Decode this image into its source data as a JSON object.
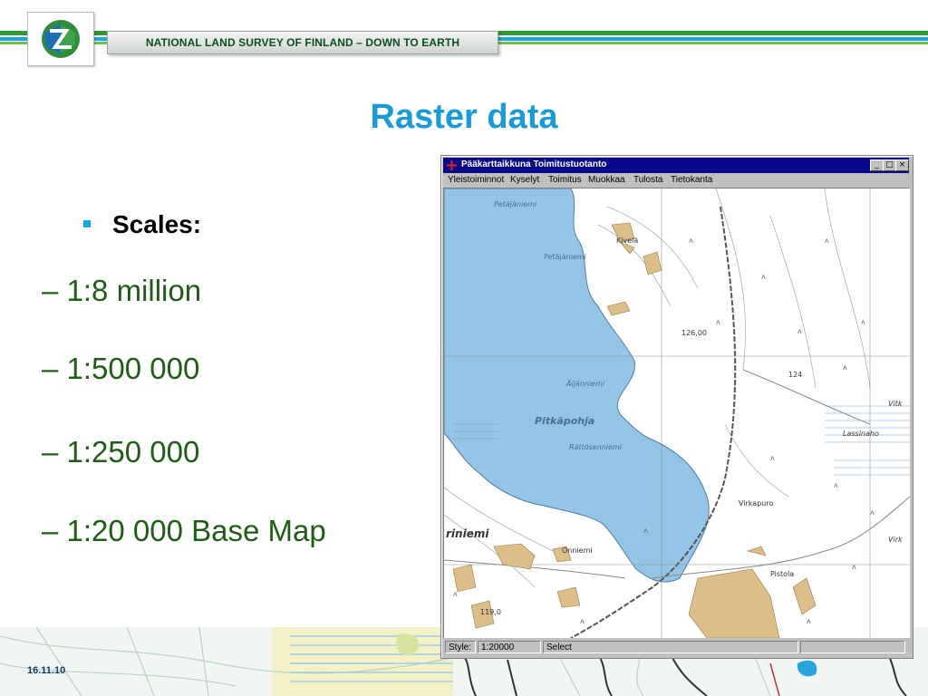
{
  "header": {
    "banner_text": "NATIONAL LAND SURVEY OF FINLAND – DOWN TO EARTH",
    "logo_icon": "nls-globe-logo-icon"
  },
  "slide": {
    "title": "Raster data",
    "bullet_heading": "Scales:",
    "scales": [
      "– 1:8 million",
      "– 1:500 000",
      "– 1:250 000",
      "– 1:20 000 Base Map"
    ]
  },
  "window": {
    "title": "Pääkarttaikkuna Toimitustuotanto",
    "menu": [
      "Yleistoiminnot",
      "Kyselyt",
      "Toimitus",
      "Muokkaa",
      "Tulosta",
      "Tietokanta"
    ],
    "buttons": {
      "minimize": "_",
      "maximize": "□",
      "close": "×"
    },
    "map_labels": [
      "Petäjäniemi",
      "Kivelä",
      "Petäjäniemi",
      "126,00",
      "124",
      "Äijänniemi",
      "Pitkäpohja",
      "Rättösenniemi",
      "Lassinaho",
      "Virkapuro",
      "riniemi",
      "Onniemi",
      "119,0",
      "Pistola",
      "Vitk",
      "Virk"
    ],
    "status": {
      "style_label": "Style:",
      "scale_value": "1:20000",
      "mode_value": "Select"
    }
  },
  "footer": {
    "date": "16.11.10"
  },
  "colors": {
    "title_blue": "#1a9bd7",
    "scale_green": "#1f5d16",
    "lake_blue": "#94c4e6",
    "field_tan": "#dcbe8a",
    "window_title": "#08088a"
  }
}
